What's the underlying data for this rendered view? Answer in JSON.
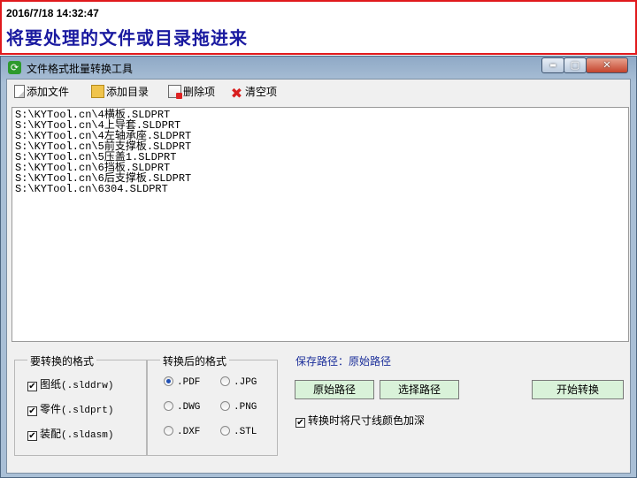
{
  "banner": {
    "timestamp": "2016/7/18 14:32:47",
    "hint": "将要处理的文件或目录拖进来"
  },
  "window": {
    "title": "文件格式批量转换工具",
    "controls": {
      "minimize": "▬",
      "maximize": "▢",
      "close": "✕"
    }
  },
  "toolbar": {
    "add_file": "添加文件",
    "add_dir": "添加目录",
    "delete_item": "删除项",
    "clear": "清空项"
  },
  "file_list": [
    "S:\\KYTool.cn\\4横板.SLDPRT",
    "S:\\KYTool.cn\\4上导套.SLDPRT",
    "S:\\KYTool.cn\\4左轴承座.SLDPRT",
    "S:\\KYTool.cn\\5前支撑板.SLDPRT",
    "S:\\KYTool.cn\\5压盖1.SLDPRT",
    "S:\\KYTool.cn\\6挡板.SLDPRT",
    "S:\\KYTool.cn\\6后支撑板.SLDPRT",
    "S:\\KYTool.cn\\6304.SLDPRT"
  ],
  "source_formats": {
    "legend": "要转换的格式",
    "items": [
      {
        "label": "图纸",
        "ext": "(.slddrw)",
        "checked": true
      },
      {
        "label": "零件",
        "ext": "(.sldprt)",
        "checked": true
      },
      {
        "label": "装配",
        "ext": "(.sldasm)",
        "checked": true
      }
    ]
  },
  "target_formats": {
    "legend": "转换后的格式",
    "options": [
      ".PDF",
      ".JPG",
      ".DWG",
      ".PNG",
      ".DXF",
      ".STL"
    ],
    "selected": ".PDF"
  },
  "save": {
    "label": "保存路径：",
    "value": "原始路径",
    "btn_original": "原始路径",
    "btn_choose": "选择路径",
    "btn_start": "开始转换"
  },
  "deepen_lines": {
    "label": "转换时将尺寸线颜色加深",
    "checked": true
  },
  "colors": {
    "banner_border": "#e0191c",
    "hint_text": "#1a1aa0",
    "button_bg": "#d9f2d9",
    "save_label": "#1c2f9a"
  }
}
